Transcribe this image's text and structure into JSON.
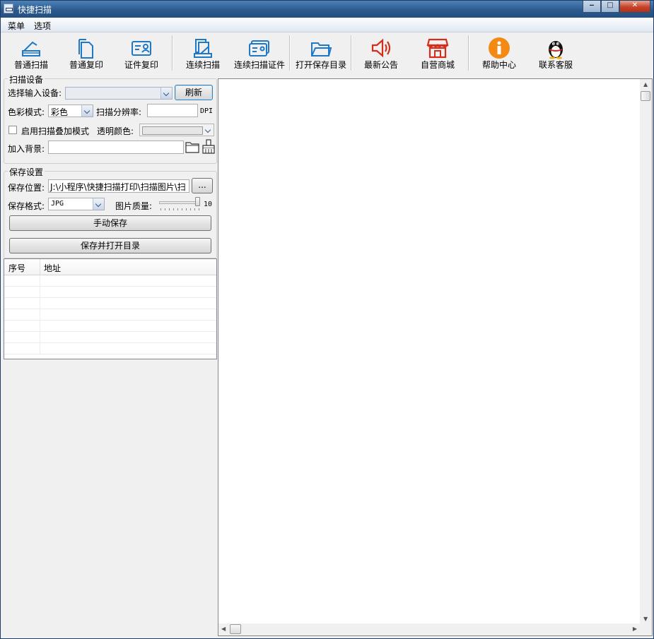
{
  "window": {
    "title": "快捷扫描"
  },
  "menu": {
    "items": [
      "菜单",
      "选项"
    ]
  },
  "toolbar": {
    "buttons": [
      {
        "label": "普通扫描",
        "icon": "scanner-icon"
      },
      {
        "label": "普通复印",
        "icon": "document-copy-icon"
      },
      {
        "label": "证件复印",
        "icon": "id-card-icon"
      },
      {
        "label": "连续扫描",
        "icon": "continuous-scan-icon"
      },
      {
        "label": "连续扫描证件",
        "icon": "id-card-scan-icon"
      },
      {
        "label": "打开保存目录",
        "icon": "folder-open-icon"
      },
      {
        "label": "最新公告",
        "icon": "speaker-icon"
      },
      {
        "label": "自营商城",
        "icon": "store-icon"
      },
      {
        "label": "帮助中心",
        "icon": "info-icon"
      },
      {
        "label": "联系客服",
        "icon": "qq-penguin-icon"
      }
    ]
  },
  "scan_settings": {
    "group_title": "扫描设备",
    "device_label": "选择输入设备:",
    "device_value": "",
    "refresh_label": "刷新",
    "color_mode_label": "色彩模式:",
    "color_mode_value": "彩色",
    "resolution_label": "扫描分辨率:",
    "resolution_value": "",
    "resolution_unit": "DPI",
    "overlay_label": "启用扫描叠加模式",
    "overlay_checked": false,
    "transparent_label": "透明颜色:",
    "background_label": "加入背景:",
    "background_value": ""
  },
  "save_settings": {
    "group_title": "保存设置",
    "location_label": "保存位置:",
    "location_value": "J:\\小程序\\快捷扫描打印\\扫描图片\\扫",
    "browse_label": "...",
    "format_label": "保存格式:",
    "format_value": "JPG",
    "quality_label": "图片质量:",
    "quality_value": "10",
    "quality_level": 1.0,
    "manual_save_label": "手动保存",
    "save_open_label": "保存并打开目录"
  },
  "list": {
    "columns": [
      "序号",
      "地址"
    ],
    "rows": []
  }
}
